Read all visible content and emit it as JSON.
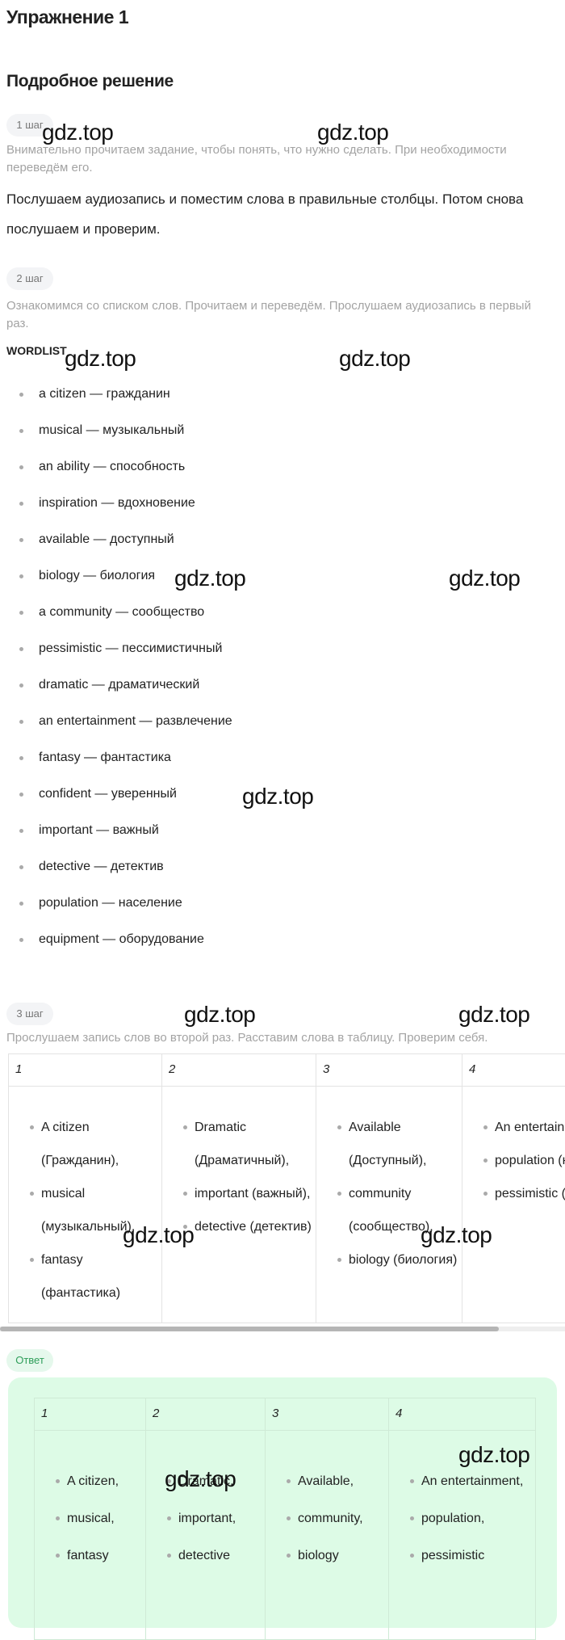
{
  "title": "Упражнение 1",
  "subtitle": "Подробное решение",
  "steps": [
    {
      "badge": "1 шаг",
      "hint": "Внимательно прочитаем задание, чтобы понять, что нужно сделать. При необходимости переведём его.",
      "text": "Послушаем аудиозапись и поместим слова в правильные столбцы. Потом снова послушаем и проверим."
    },
    {
      "badge": "2 шаг",
      "hint": "Ознакомимся со списком слов. Прочитаем и переведём. Прослушаем аудиозапись в первый раз.",
      "wordlist_label": "WORDLIST",
      "words": [
        "a citizen — гражданин",
        "musical — музыкальный",
        "an ability — способность",
        "inspiration — вдохновение",
        "available — доступный",
        "biology — биология",
        "a community — сообщество",
        "pessimistic — пессимистичный",
        "dramatic — драматический",
        "an entertainment — развлечение",
        "fantasy — фантастика",
        "confident — уверенный",
        "important — важный",
        "detective — детектив",
        "population — население",
        "equipment — оборудование"
      ]
    },
    {
      "badge": "3 шаг",
      "hint": "Прослушаем запись слов во второй раз. Расставим слова в таблицу. Проверим себя.",
      "table": {
        "headers": [
          "1",
          "2",
          "3",
          "4"
        ],
        "columns": [
          [
            "A citizen (Гражданин),",
            "musical (музыкальный),",
            "fantasy (фантастика)"
          ],
          [
            "Dramatic (Драматичный),",
            "important (важный),",
            "detective (детектив)"
          ],
          [
            "Available (Доступный),",
            "community (сообщество),",
            "biology (биология)"
          ],
          [
            "An entertainment (Развлечение),",
            "population (население),",
            "pessimistic (пессимистичный)"
          ]
        ]
      }
    }
  ],
  "answer": {
    "badge": "Ответ",
    "table": {
      "headers": [
        "1",
        "2",
        "3",
        "4"
      ],
      "columns": [
        [
          "A citizen,",
          "musical,",
          "fantasy"
        ],
        [
          "Dramatic,",
          "important,",
          "detective"
        ],
        [
          "Available,",
          "community,",
          "biology"
        ],
        [
          "An entertainment,",
          "population,",
          "pessimistic"
        ]
      ]
    }
  },
  "watermark": "gdz.top",
  "colors": {
    "answer_bg": "#ddfbe6",
    "answer_text": "#2f9e5a",
    "hint": "#a3a3a3"
  }
}
